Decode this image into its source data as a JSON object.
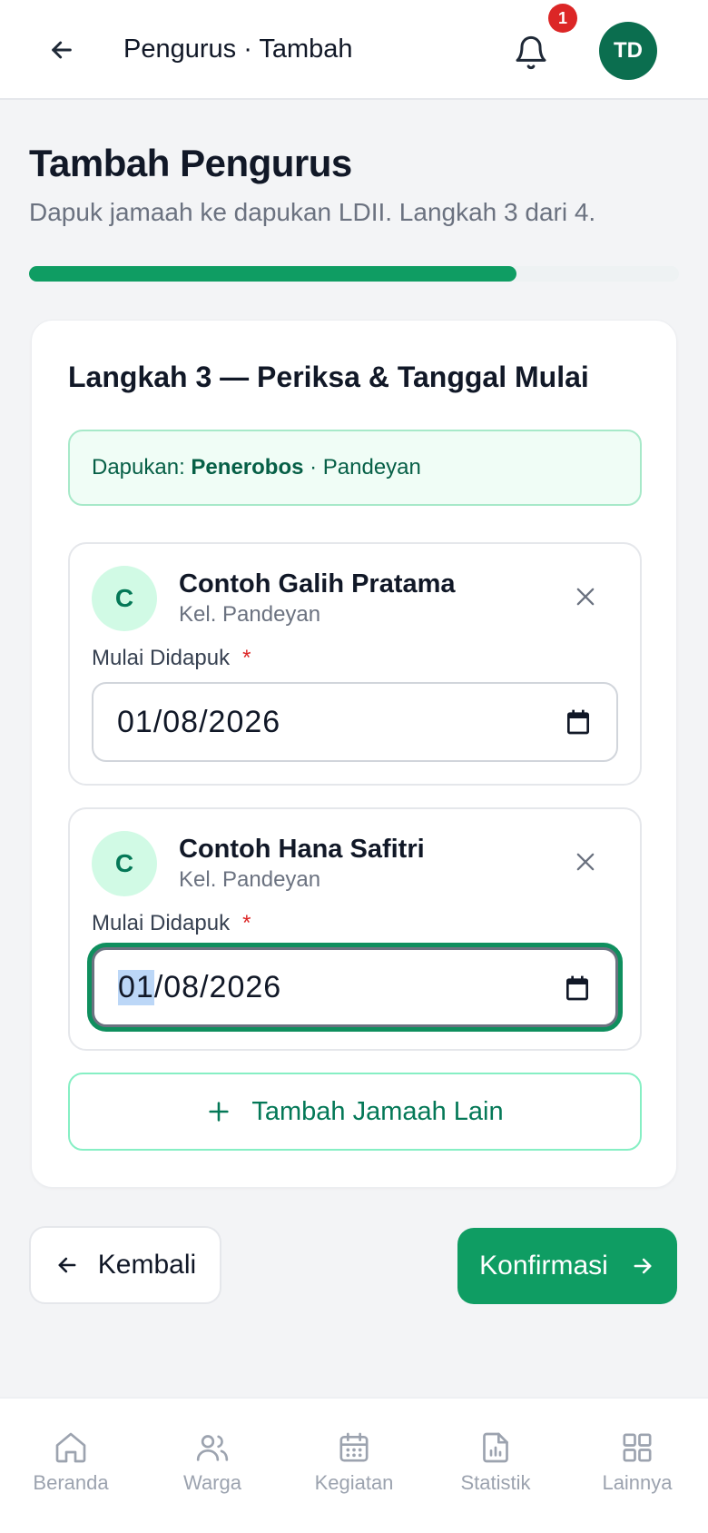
{
  "header": {
    "title": "Pengurus · Tambah",
    "notification_count": "1",
    "avatar_initials": "TD"
  },
  "page": {
    "title": "Tambah Pengurus",
    "subtitle": "Dapuk jamaah ke dapukan LDII. Langkah 3 dari 4.",
    "progress_fraction": 0.75
  },
  "step": {
    "title": "Langkah 3 — Periksa & Tanggal Mulai",
    "dapukan_prefix": "Dapukan:",
    "dapukan_name": "Penerobos",
    "dapukan_location": "· Pandeyan"
  },
  "members": [
    {
      "initial": "C",
      "name": "Contoh Galih Pratama",
      "sub": "Kel. Pandeyan",
      "date_label": "Mulai Didapuk",
      "required_mark": "*",
      "date_value": "01/08/2026"
    },
    {
      "initial": "C",
      "name": "Contoh Hana Safitri",
      "sub": "Kel. Pandeyan",
      "date_label": "Mulai Didapuk",
      "required_mark": "*",
      "date_day": "01",
      "date_rest": "/08/2026"
    }
  ],
  "actions": {
    "add_member": "Tambah Jamaah Lain",
    "back": "Kembali",
    "confirm": "Konfirmasi"
  },
  "nav": {
    "items": [
      {
        "label": "Beranda",
        "icon": "home-icon"
      },
      {
        "label": "Warga",
        "icon": "users-icon"
      },
      {
        "label": "Kegiatan",
        "icon": "calendar-icon"
      },
      {
        "label": "Statistik",
        "icon": "report-chart-icon"
      },
      {
        "label": "Lainnya",
        "icon": "grid-icon"
      }
    ]
  },
  "colors": {
    "primary": "#0f9d63",
    "primary_dark": "#0b6e4f",
    "badge": "#dc2626",
    "light_green_bg": "#f0fdf6"
  }
}
